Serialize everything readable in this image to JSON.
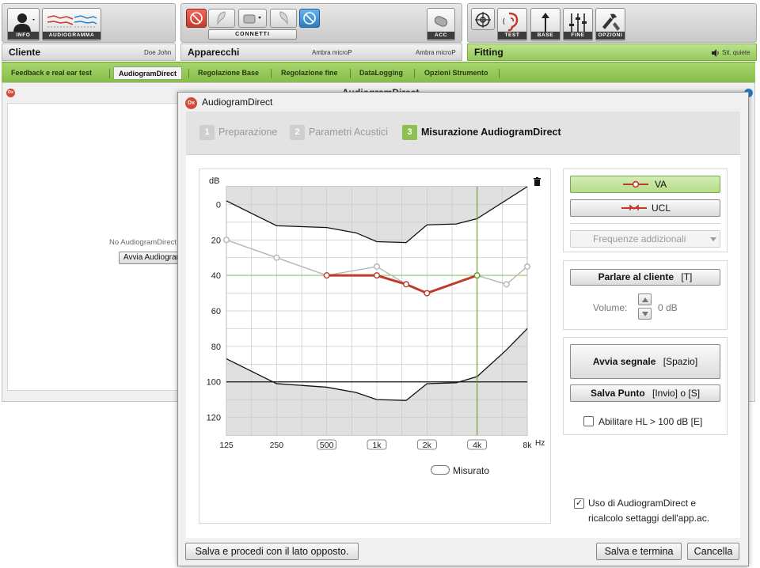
{
  "toolbar": {
    "info_label": "INFO",
    "audiogramma_label": "AUDIOGRAMMA",
    "connetti_label": "CONNETTI",
    "acc_label": "ACC",
    "test_label": "TEST",
    "base_label": "BASE",
    "fine_label": "FINE",
    "opzioni_label": "OPZIONI"
  },
  "sections": {
    "cliente_title": "Cliente",
    "cliente_name": "Doe John",
    "apparecchi_title": "Apparecchi",
    "apparecchi_left_device": "Ambra microP",
    "apparecchi_right_device": "Ambra microP",
    "fitting_title": "Fitting",
    "fitting_status": "Sit. quiete"
  },
  "tabs": [
    {
      "label": "Feedback e real ear test"
    },
    {
      "label": "AudiogramDirect"
    },
    {
      "label": "Regolazione Base"
    },
    {
      "label": "Regolazione fine"
    },
    {
      "label": "DataLogging"
    },
    {
      "label": "Opzioni Strumento"
    }
  ],
  "background": {
    "title": "AudiogramDirect",
    "no_audiogram_text": "No AudiogramDirect",
    "start_button": "Avvia AudiogramDirect",
    "dx_badge": "Dx"
  },
  "dialog": {
    "title": "AudiogramDirect",
    "dx_badge": "Dx",
    "steps": [
      {
        "num": "1",
        "label": "Preparazione",
        "active": false
      },
      {
        "num": "2",
        "label": "Parametri Acustici",
        "active": false
      },
      {
        "num": "3",
        "label": "Misurazione AudiogramDirect",
        "active": true
      }
    ],
    "legend_va": "VA",
    "legend_ucl": "UCL",
    "frequenze_placeholder": "Frequenze addizionali",
    "talk_button": "Parlare al cliente",
    "talk_shortcut": "[T]",
    "volume_label": "Volume:",
    "volume_value": "0 dB",
    "start_signal_button": "Avvia segnale",
    "start_signal_shortcut": "[Spazio]",
    "save_point_button": "Salva Punto",
    "save_point_shortcut": "[Invio] o [S]",
    "enable_hl_label": "Abilitare HL > 100 dB [E]",
    "enable_hl_checked": false,
    "misurato_label": "Misurato",
    "use_audiogram_label_line1": "Uso di AudiogramDirect e",
    "use_audiogram_label_line2": "ricalcolo settaggi dell'app.ac.",
    "use_audiogram_checked": true,
    "btn_save_opposite": "Salva e procedi con il lato opposto.",
    "btn_save_end": "Salva e termina",
    "btn_cancel": "Cancella"
  },
  "colors": {
    "accent_green": "#8cc152",
    "ear_right_red": "#c0392b",
    "step_active": "#8cc152",
    "step_inactive": "#cfcfcf"
  },
  "chart_data": {
    "type": "line",
    "ylabel": "dB",
    "xlabel": "Hz",
    "y_inverted": true,
    "ylim": [
      -10,
      130
    ],
    "y_ticks": [
      0,
      20,
      40,
      60,
      80,
      100,
      120
    ],
    "x_scale": "log",
    "x_ticks": [
      {
        "hz": 125,
        "label": "125",
        "boxed": false
      },
      {
        "hz": 250,
        "label": "250",
        "boxed": false
      },
      {
        "hz": 500,
        "label": "500",
        "boxed": true
      },
      {
        "hz": 1000,
        "label": "1k",
        "boxed": true
      },
      {
        "hz": 2000,
        "label": "2k",
        "boxed": true
      },
      {
        "hz": 4000,
        "label": "4k",
        "boxed": true
      },
      {
        "hz": 8000,
        "label": "8k",
        "boxed": false
      }
    ],
    "cursor": {
      "hz": 4000,
      "db": 40
    },
    "upper_range_boundary": [
      {
        "hz": 125,
        "db": -2
      },
      {
        "hz": 250,
        "db": 12
      },
      {
        "hz": 500,
        "db": 13
      },
      {
        "hz": 750,
        "db": 16
      },
      {
        "hz": 1000,
        "db": 21
      },
      {
        "hz": 1500,
        "db": 21.5
      },
      {
        "hz": 2000,
        "db": 11.5
      },
      {
        "hz": 3000,
        "db": 11
      },
      {
        "hz": 4000,
        "db": 8
      },
      {
        "hz": 8000,
        "db": -10
      }
    ],
    "lower_range_boundary": [
      {
        "hz": 125,
        "db": 87
      },
      {
        "hz": 250,
        "db": 101
      },
      {
        "hz": 500,
        "db": 103
      },
      {
        "hz": 750,
        "db": 106
      },
      {
        "hz": 1000,
        "db": 110
      },
      {
        "hz": 1500,
        "db": 110.5
      },
      {
        "hz": 2000,
        "db": 101
      },
      {
        "hz": 3000,
        "db": 100.5
      },
      {
        "hz": 4000,
        "db": 97
      },
      {
        "hz": 6000,
        "db": 82
      },
      {
        "hz": 8000,
        "db": 70
      }
    ],
    "reference_line_db": 100,
    "series": [
      {
        "key": "reference",
        "color": "#b5b5b5",
        "points": [
          {
            "hz": 125,
            "db": 20
          },
          {
            "hz": 250,
            "db": 30
          },
          {
            "hz": 500,
            "db": 40
          },
          {
            "hz": 1000,
            "db": 35
          },
          {
            "hz": 1500,
            "db": 45
          },
          {
            "hz": 2000,
            "db": 50
          },
          {
            "hz": 4000,
            "db": 40
          },
          {
            "hz": 6000,
            "db": 45
          },
          {
            "hz": 8000,
            "db": 35
          }
        ]
      },
      {
        "key": "va_measured",
        "color": "#c0392b",
        "points": [
          {
            "hz": 500,
            "db": 40
          },
          {
            "hz": 1000,
            "db": 40
          },
          {
            "hz": 1500,
            "db": 45
          },
          {
            "hz": 2000,
            "db": 50
          },
          {
            "hz": 4000,
            "db": 40
          }
        ]
      }
    ]
  }
}
